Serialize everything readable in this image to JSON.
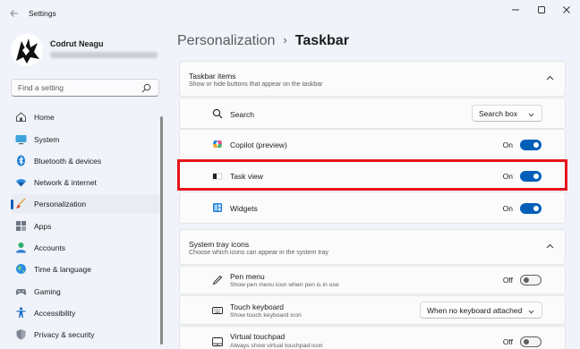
{
  "window": {
    "title": "Settings",
    "back_icon": "back-arrow-icon",
    "controls": [
      "minimize-icon",
      "maximize-icon",
      "close-icon"
    ]
  },
  "profile": {
    "name": "Codrut Neagu"
  },
  "search": {
    "placeholder": "Find a setting"
  },
  "sidebar": {
    "items": [
      {
        "label": "Home",
        "icon": "home-icon"
      },
      {
        "label": "System",
        "icon": "system-icon"
      },
      {
        "label": "Bluetooth & devices",
        "icon": "bluetooth-icon"
      },
      {
        "label": "Network & internet",
        "icon": "wifi-icon"
      },
      {
        "label": "Personalization",
        "icon": "brush-icon",
        "active": true
      },
      {
        "label": "Apps",
        "icon": "apps-icon"
      },
      {
        "label": "Accounts",
        "icon": "accounts-icon"
      },
      {
        "label": "Time & language",
        "icon": "globe-icon"
      },
      {
        "label": "Gaming",
        "icon": "gaming-icon"
      },
      {
        "label": "Accessibility",
        "icon": "accessibility-icon"
      },
      {
        "label": "Privacy & security",
        "icon": "shield-icon"
      }
    ]
  },
  "breadcrumb": {
    "parent": "Personalization",
    "separator": "›",
    "current": "Taskbar"
  },
  "taskbar_items": {
    "title": "Taskbar items",
    "subtitle": "Show or hide buttons that appear on the taskbar",
    "rows": [
      {
        "label": "Search",
        "icon": "search-icon",
        "control": "dropdown",
        "value": "Search box"
      },
      {
        "label": "Copilot (preview)",
        "icon": "copilot-icon",
        "control": "toggle",
        "state": "On"
      },
      {
        "label": "Task view",
        "icon": "task-view-icon",
        "control": "toggle",
        "state": "On"
      },
      {
        "label": "Widgets",
        "icon": "widgets-icon",
        "control": "toggle",
        "state": "On"
      }
    ]
  },
  "system_tray": {
    "title": "System tray icons",
    "subtitle": "Choose which icons can appear in the system tray",
    "rows": [
      {
        "label": "Pen menu",
        "sub": "Show pen menu icon when pen is in use",
        "icon": "pen-icon",
        "control": "toggle",
        "state": "Off"
      },
      {
        "label": "Touch keyboard",
        "sub": "Show touch keyboard icon",
        "icon": "keyboard-icon",
        "control": "dropdown",
        "value": "When no keyboard attached"
      },
      {
        "label": "Virtual touchpad",
        "sub": "Always show virtual touchpad icon",
        "icon": "touchpad-icon",
        "control": "toggle",
        "state": "Off"
      }
    ]
  },
  "colors": {
    "accent": "#005fb8",
    "highlight": "#e8141c"
  }
}
